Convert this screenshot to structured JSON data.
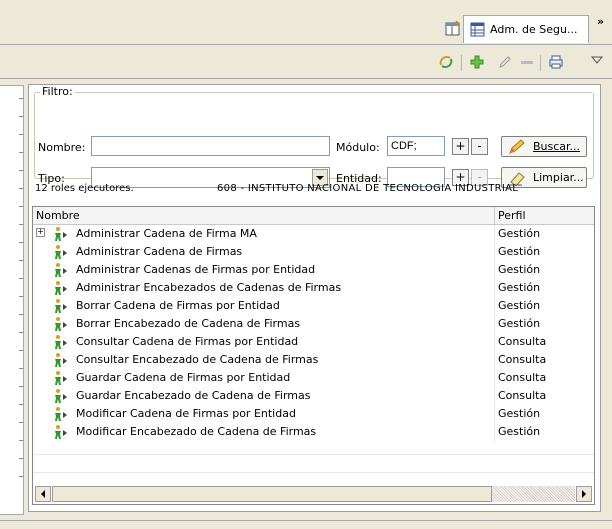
{
  "tab": {
    "label": "Adm. de Segu...",
    "overflow_label": "»"
  },
  "toolbar": {
    "icons": [
      "refresh-icon",
      "add-icon",
      "edit-icon",
      "remove-icon",
      "print-icon",
      "view-menu-icon"
    ]
  },
  "filter": {
    "legend": "Filtro:",
    "nombre_label": "Nombre:",
    "nombre_value": "",
    "modulo_label": "Módulo:",
    "modulo_value": "CDF;",
    "tipo_label": "Tipo:",
    "tipo_value": "",
    "entidad_label": "Entidad:",
    "entidad_value": "",
    "plus": "+",
    "minus": "-",
    "buscar_label": "Buscar...",
    "limpiar_label": "Limpiar..."
  },
  "status": {
    "count_text": "12 roles ejecutores.",
    "institution": "608 - INSTITUTO NACIONAL DE TECNOLOGIA INDUSTRIAL"
  },
  "table": {
    "columns": [
      "Nombre",
      "Perfil"
    ],
    "rows": [
      {
        "name": "Administrar Cadena de Firma MA",
        "perfil": "Gestión",
        "expandable": true
      },
      {
        "name": "Administrar Cadena de Firmas",
        "perfil": "Gestión"
      },
      {
        "name": "Administrar Cadenas de Firmas por Entidad",
        "perfil": "Gestión"
      },
      {
        "name": "Administrar Encabezados de Cadenas de Firmas",
        "perfil": "Gestión"
      },
      {
        "name": "Borrar Cadena de Firmas por Entidad",
        "perfil": "Gestión"
      },
      {
        "name": "Borrar Encabezado de Cadena de Firmas",
        "perfil": "Gestión"
      },
      {
        "name": "Consultar Cadena de Firmas por Entidad",
        "perfil": "Consulta"
      },
      {
        "name": "Consultar Encabezado de Cadena de Firmas",
        "perfil": "Consulta"
      },
      {
        "name": "Guardar Cadena de Firmas por Entidad",
        "perfil": "Consulta"
      },
      {
        "name": "Guardar Encabezado de Cadena de Firmas",
        "perfil": "Consulta"
      },
      {
        "name": "Modificar Cadena de Firmas por Entidad",
        "perfil": "Gestión"
      },
      {
        "name": "Modificar Encabezado de Cadena de Firmas",
        "perfil": "Gestión"
      }
    ]
  },
  "colors": {
    "chrome": "#ece9d8",
    "border": "#7f9db9",
    "icon_green": "#2e9a2e"
  }
}
